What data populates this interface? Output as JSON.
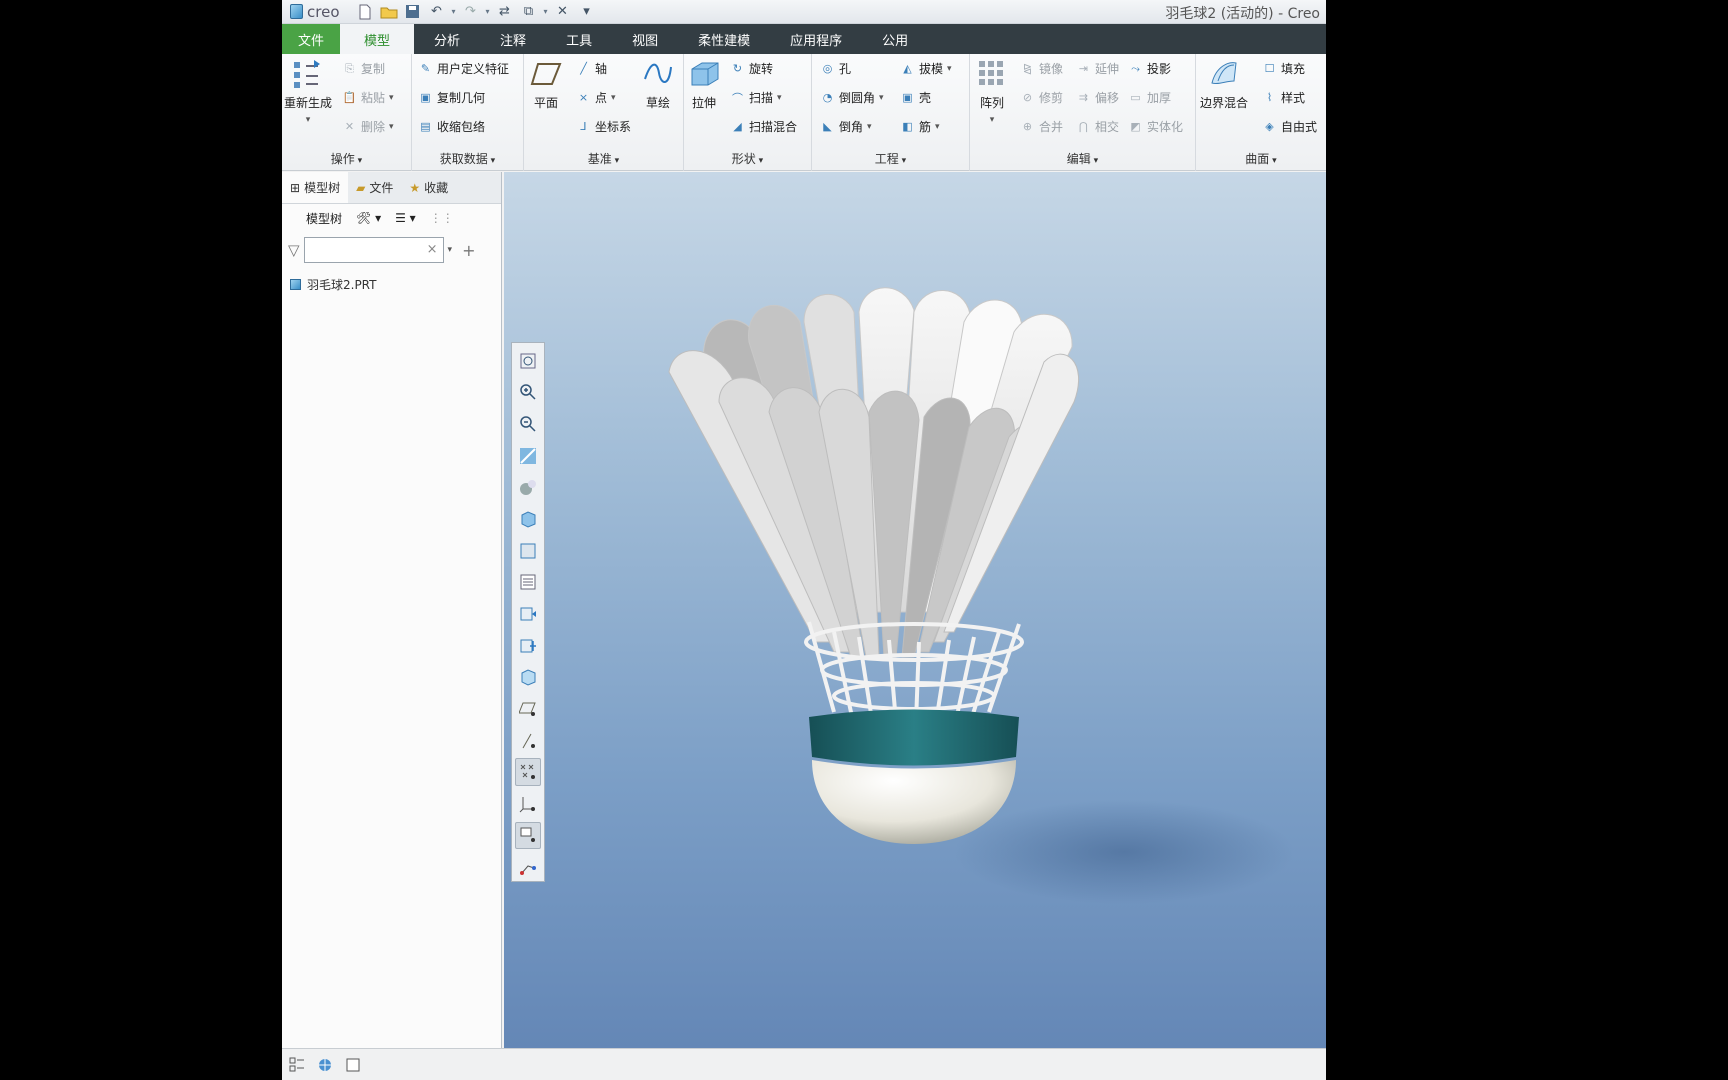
{
  "app": {
    "logo_text": "creo",
    "window_title": "羽毛球2 (活动的) - Creo"
  },
  "tabs": [
    {
      "label": "文件"
    },
    {
      "label": "模型"
    },
    {
      "label": "分析"
    },
    {
      "label": "注释"
    },
    {
      "label": "工具"
    },
    {
      "label": "视图"
    },
    {
      "label": "柔性建模"
    },
    {
      "label": "应用程序"
    },
    {
      "label": "公用"
    }
  ],
  "ribbon": {
    "ops": {
      "label": "操作",
      "regen": "重新生成",
      "copy": "复制",
      "paste": "粘贴",
      "delete": "删除"
    },
    "getdata": {
      "label": "获取数据",
      "udf": "用户定义特征",
      "copygeom": "复制几何",
      "shrink": "收缩包络"
    },
    "datum": {
      "label": "基准",
      "plane": "平面",
      "axis": "轴",
      "point": "点",
      "csys": "坐标系",
      "sketch": "草绘"
    },
    "shape": {
      "label": "形状",
      "extrude": "拉伸",
      "revolve": "旋转",
      "sweep": "扫描",
      "sweepblend": "扫描混合"
    },
    "engineering": {
      "label": "工程",
      "hole": "孔",
      "round": "倒圆角",
      "chamfer": "倒角",
      "draft": "拔模",
      "shell": "壳",
      "rib": "筋"
    },
    "editing": {
      "label": "编辑",
      "pattern": "阵列",
      "mirror": "镜像",
      "trim": "修剪",
      "merge": "合并",
      "extend": "延伸",
      "offset": "偏移",
      "intersect": "相交",
      "project": "投影",
      "thicken": "加厚",
      "solidify": "实体化"
    },
    "surfaces": {
      "label": "曲面",
      "boundary": "边界混合",
      "fill": "填充",
      "style": "样式",
      "freestyle": "自由式"
    }
  },
  "leftpanel": {
    "tabs": [
      {
        "label": "模型树"
      },
      {
        "label": "文件"
      },
      {
        "label": "收藏"
      }
    ],
    "tree_label": "模型树",
    "filter_value": "",
    "items": [
      {
        "label": "羽毛球2.PRT"
      }
    ]
  },
  "viewport": {
    "background_top": "#c6d7e6",
    "background_bottom": "#6487b6",
    "band_color": "#1f6d72"
  }
}
